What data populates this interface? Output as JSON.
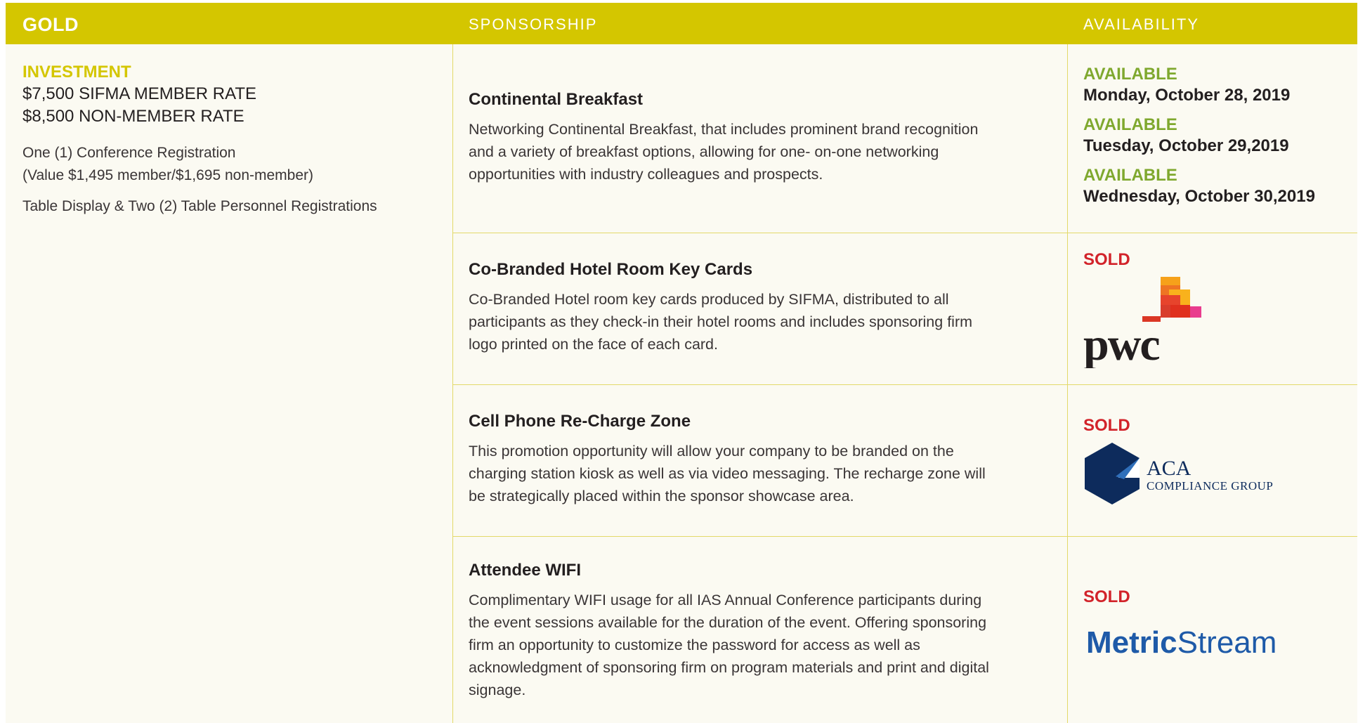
{
  "header": {
    "tier": "GOLD",
    "sponsorship": "SPONSORSHIP",
    "availability": "AVAILABILITY"
  },
  "investment": {
    "label": "INVESTMENT",
    "member_rate": "$7,500 SIFMA MEMBER RATE",
    "nonmember_rate": "$8,500 NON-MEMBER RATE",
    "benefit_1_line_1": "One (1) Conference Registration",
    "benefit_1_line_2": "(Value $1,495 member/$1,695 non-member)",
    "benefit_2": "Table Display & Two (2) Table Personnel Registrations"
  },
  "sponsorships": [
    {
      "title": "Continental Breakfast",
      "lines": [
        "Networking Continental Breakfast, that includes prominent brand recognition",
        "and a variety of breakfast options, allowing for one- on-one networking",
        "opportunities with industry colleagues and prospects."
      ],
      "availability": [
        {
          "status": "AVAILABLE",
          "date": "Monday, October 28, 2019"
        },
        {
          "status": "AVAILABLE",
          "date": "Tuesday, October 29,2019"
        },
        {
          "status": "AVAILABLE",
          "date": "Wednesday, October 30,2019"
        }
      ]
    },
    {
      "title": "Co-Branded Hotel Room Key Cards",
      "lines": [
        "Co-Branded Hotel room key cards produced by SIFMA, distributed to all",
        "participants as they check-in their hotel rooms and includes sponsoring firm",
        "logo printed on the face of each card."
      ],
      "status": "SOLD",
      "sponsor_logo": "pwc"
    },
    {
      "title": "Cell Phone Re-Charge Zone",
      "lines": [
        "This promotion opportunity will allow your company to be branded on the",
        "charging station kiosk as well as via video messaging. The recharge zone will",
        "be strategically placed within the sponsor showcase area."
      ],
      "status": "SOLD",
      "sponsor_logo": "ACA Compliance Group",
      "logo_text_1": "ACA",
      "logo_text_2": "COMPLIANCE GROUP"
    },
    {
      "title": "Attendee WIFI",
      "lines": [
        "Complimentary WIFI usage for all IAS Annual Conference participants during",
        "the event sessions available for the duration of the event. Offering sponsoring",
        "firm an opportunity to customize the password for access as well as",
        "acknowledgment of sponsoring firm on program materials and print and digital",
        "signage."
      ],
      "status": "SOLD",
      "sponsor_logo": "MetricStream",
      "logo_text_1": "Metric",
      "logo_text_2": "Stream"
    }
  ],
  "colors": {
    "header_bg": "#d4c600",
    "available": "#7fa82e",
    "sold": "#d2232a",
    "rule": "#e3d96a",
    "metricstream_blue": "#1e5aa8",
    "aca_navy": "#0d2b5c"
  }
}
